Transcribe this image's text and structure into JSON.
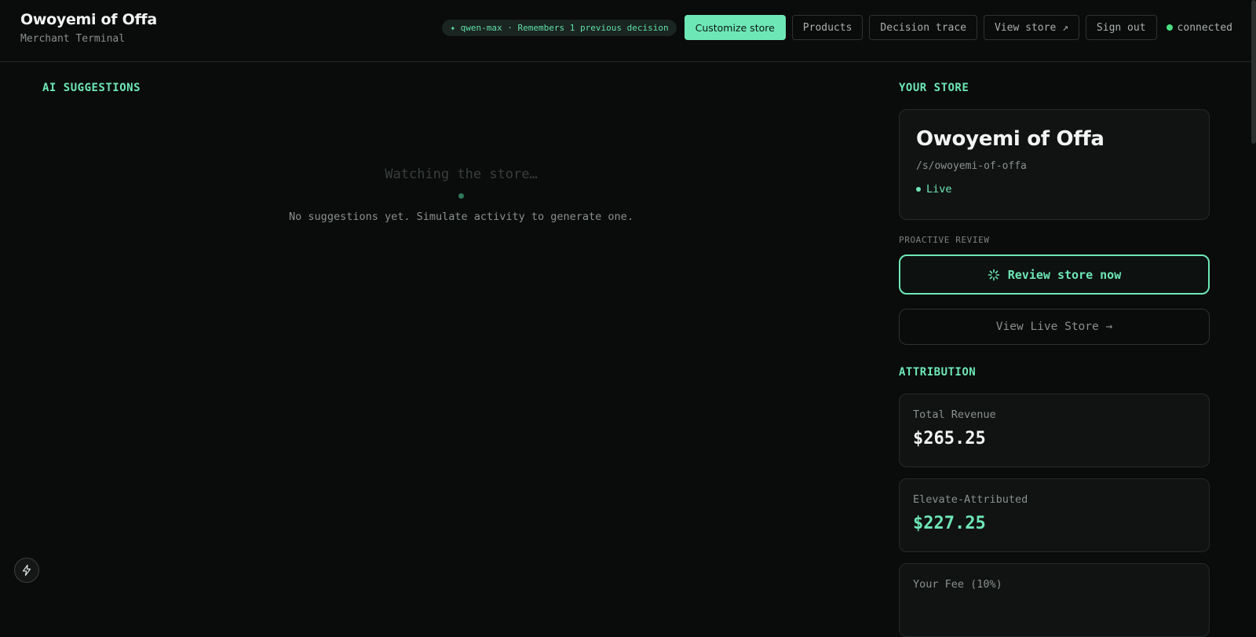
{
  "header": {
    "title": "Owoyemi of Offa",
    "subtitle": "Merchant Terminal",
    "model_pill": "✦ qwen-max · Remembers 1 previous decision",
    "buttons": {
      "customize": "Customize store",
      "products": "Products",
      "decision_trace": "Decision trace",
      "view_store": "View store ↗",
      "sign_out": "Sign out"
    },
    "status": "connected"
  },
  "suggestions": {
    "label": "AI SUGGESTIONS",
    "empty_title": "Watching the store…",
    "empty_text": "No suggestions yet. Simulate activity to generate one."
  },
  "store": {
    "label": "YOUR STORE",
    "name": "Owoyemi of Offa",
    "slug": "/s/owoyemi-of-offa",
    "status": "Live",
    "proactive_label": "PROACTIVE REVIEW",
    "review_button": "Review store now",
    "live_store_button": "View Live Store →"
  },
  "attribution": {
    "label": "ATTRIBUTION",
    "metrics": [
      {
        "label": "Total Revenue",
        "value": "$265.25"
      },
      {
        "label": "Elevate-Attributed",
        "value": "$227.25"
      },
      {
        "label": "Your Fee (10%)",
        "value": ""
      }
    ]
  },
  "colors": {
    "accent": "#6ee7b7",
    "background": "#0a0b0b",
    "status": "#4ade80"
  }
}
